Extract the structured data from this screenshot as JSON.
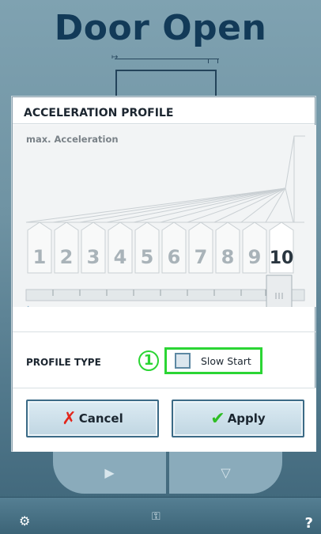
{
  "background": {
    "title": "Door Open",
    "footer_gear_icon": "gear-icon",
    "footer_key_icon": "key-icon",
    "footer_help": "?"
  },
  "dialog": {
    "title": "ACCELERATION PROFILE",
    "graph_label": "max. Acceleration",
    "profiles": [
      "1",
      "2",
      "3",
      "4",
      "5",
      "6",
      "7",
      "8",
      "9",
      "10"
    ],
    "selected_profile": "10",
    "profile_type_label": "PROFILE TYPE",
    "marker": "1",
    "slow_start_label": "Slow Start",
    "slow_start_checked": false,
    "cancel_label": "Cancel",
    "apply_label": "Apply"
  },
  "colors": {
    "highlight": "#2bd534",
    "cancel_icon": "#e2251a",
    "apply_icon": "#2fbe25",
    "title_text": "#123a58"
  }
}
